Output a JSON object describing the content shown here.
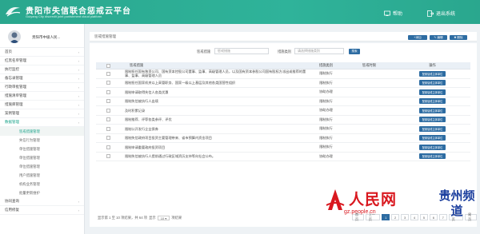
{
  "header": {
    "title": "贵阳市失信联合惩戒云平台",
    "subtitle": "Guiyang City discredit joint punishment cloud platform",
    "help_label": "帮助",
    "exit_label": "退出系统"
  },
  "user": {
    "name": "贵阳市中级人民..."
  },
  "sidebar": {
    "items": [
      {
        "label": "首页"
      },
      {
        "label": "红黑名单管理"
      },
      {
        "label": "执行监控"
      },
      {
        "label": "备忘录管理"
      },
      {
        "label": "行政审批管理"
      },
      {
        "label": "措施清单管理"
      },
      {
        "label": "措施库管理"
      },
      {
        "label": "案例管理"
      },
      {
        "label": "数据管理",
        "active": true
      }
    ],
    "sub_items": [
      {
        "label": "惩戒措施管理",
        "active": true
      },
      {
        "label": "失信行为管理"
      },
      {
        "label": "单位措施管理"
      },
      {
        "label": "单位措施管理"
      },
      {
        "label": "单位措施管理"
      },
      {
        "label": "用户措施管理"
      },
      {
        "label": "机构业务管理"
      },
      {
        "label": "批量更新维护"
      }
    ],
    "bottom_items": [
      {
        "label": "协同查询"
      },
      {
        "label": "信用修复"
      }
    ]
  },
  "breadcrumb": "惩戒措施管理",
  "toolbar": {
    "add_label": "+添加",
    "edit_label": "✎ 编辑",
    "delete_label": "✖ 删除"
  },
  "filters": {
    "measure_label": "惩戒措施",
    "measure_placeholder": "惩戒措施",
    "type_label": "措施类别",
    "type_placeholder": "请选择措施类别",
    "search_label": "搜索"
  },
  "table": {
    "headers": [
      "惩戒措施",
      "措施类别",
      "惩戒时限",
      "操作"
    ],
    "op_label": "配置惩戒主体单位",
    "rows": [
      {
        "measure": "限制担任国有独资公司、国有资本控股公司董事、监事、高级管理人员，以及国有资本参股公司国有股权方派出或推荐的董事、监事、高级管理人员",
        "type": "限制执行",
        "time": ""
      },
      {
        "measure": "限制担任国家机关以上高管职务、国家一级以上基层及其他各类国营性组织",
        "type": "限制执行",
        "time": ""
      },
      {
        "measure": "限制申请取得失信人各类优惠",
        "type": "协助办理",
        "time": ""
      },
      {
        "measure": "限制失信被执行人出境",
        "type": "限制执行",
        "time": ""
      },
      {
        "measure": "及时积累记录",
        "type": "协助办理",
        "time": ""
      },
      {
        "measure": "限制推荐、评荐各类参评、评优",
        "type": "限制执行",
        "time": ""
      },
      {
        "measure": "限制公开发行企业债券",
        "type": "限制执行",
        "time": ""
      },
      {
        "measure": "限制失信政府项目投资主要管理带来、省市预算内资金项目",
        "type": "限制执行",
        "time": ""
      },
      {
        "measure": "限制申请重要政府投资项目",
        "type": "限制执行",
        "time": ""
      },
      {
        "measure": "限制失信被执行人提前通过行政区域资历支持等向社会公布。",
        "type": "协助办理",
        "time": ""
      }
    ]
  },
  "pagination": {
    "info_prefix": "显示第 1 至 10 项结果，共 64 项",
    "show_label": "显示",
    "page_size": "10",
    "suffix": "项结果",
    "pages": [
      "首页",
      "上一页",
      "1",
      "2",
      "3",
      "4",
      "5",
      "6",
      "7",
      "下一页",
      "尾页"
    ],
    "current": "1"
  },
  "watermark": {
    "brand": "人民网",
    "url": "gz.people.cn",
    "right_text": "贵州频道"
  },
  "colors": {
    "header": "#2aa78e",
    "primary_button": "#2d6ca2",
    "brand_red": "#d9181f",
    "brand_blue": "#1c3f9e"
  }
}
